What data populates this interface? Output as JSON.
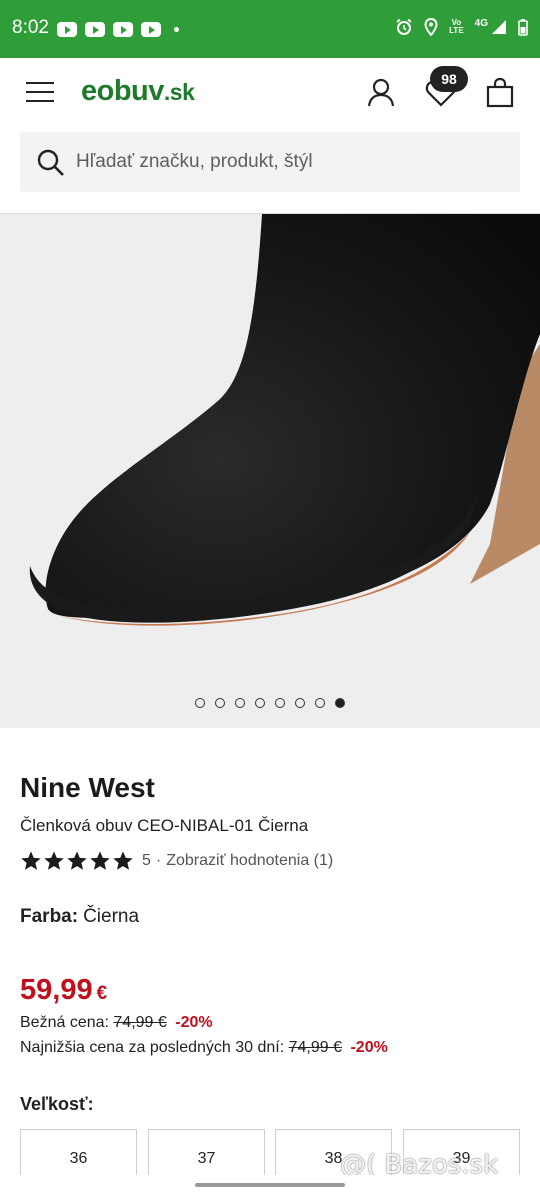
{
  "status_bar": {
    "time": "8:02",
    "app_icons": [
      "youtube-icon",
      "youtube-icon",
      "youtube-icon",
      "youtube-icon"
    ],
    "volte_line1": "Vo",
    "volte_line2": "LTE",
    "network": "4G",
    "bg_color": "#2f9e38"
  },
  "header": {
    "logo_main": "eobuv",
    "logo_tld": ".sk",
    "wishlist_count": "98",
    "icons": [
      "menu-icon",
      "account-icon",
      "heart-icon",
      "bag-icon"
    ],
    "logo_color": "#1f7a2c"
  },
  "search": {
    "placeholder": "Hľadať značku, produkt, štýl"
  },
  "gallery": {
    "image": "product-photo-black-suede-ankle-boot",
    "total_images": 8,
    "active_index": 8
  },
  "product": {
    "brand": "Nine West",
    "name": "Členková obuv CEO-NIBAL-01 Čierna",
    "rating_stars": 5,
    "rating_value": "5",
    "rating_separator": "·",
    "rating_link": "Zobraziť hodnotenia (1)",
    "color_label": "Farba:",
    "color_value": "Čierna",
    "price_value": "59,99",
    "price_currency": "€",
    "price_color": "#c0101e",
    "regular_label": "Bežná cena:",
    "regular_price": "74,99 €",
    "regular_discount": "-20%",
    "lowest_label": "Najnižšia cena za posledných 30 dní:",
    "lowest_price": "74,99 €",
    "lowest_discount": "-20%",
    "size_label": "Veľkosť:",
    "sizes": [
      "36",
      "37",
      "38",
      "39"
    ]
  },
  "watermark": {
    "text": "@( Bazos.sk"
  }
}
